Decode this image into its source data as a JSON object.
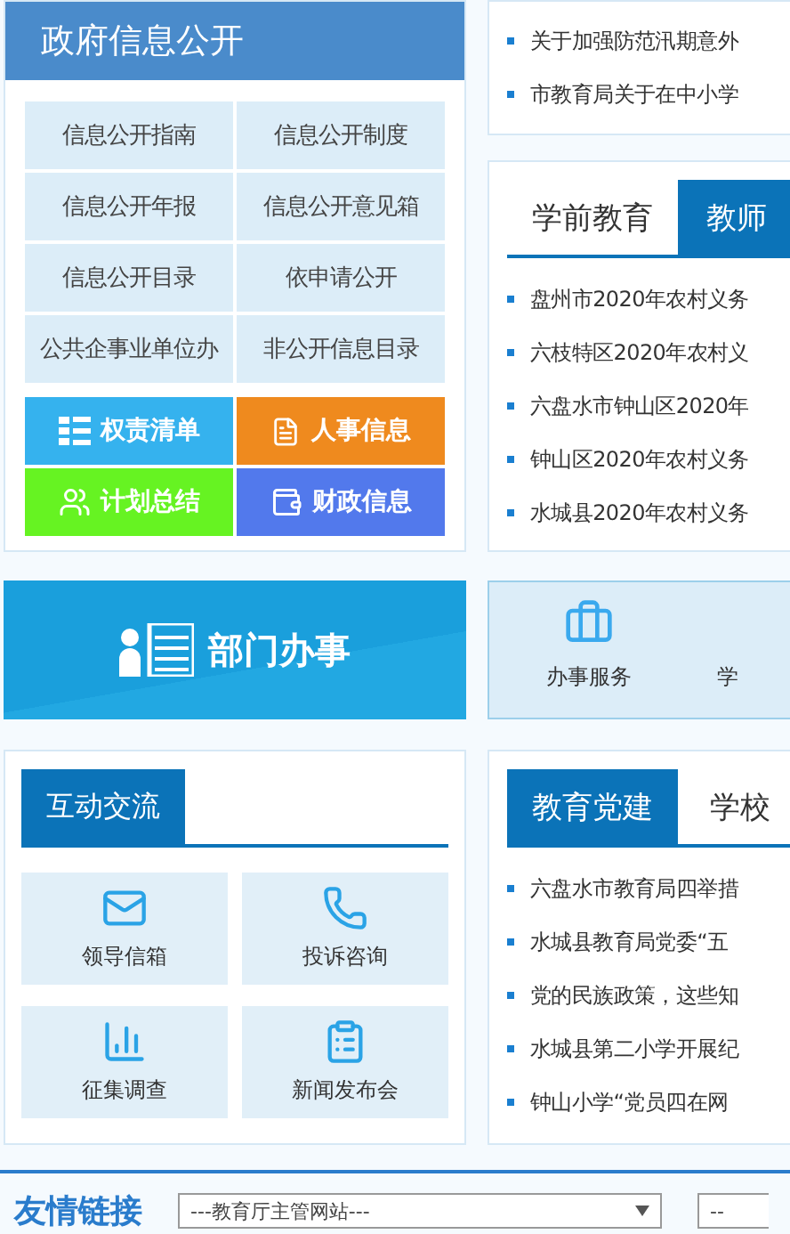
{
  "gov_info": {
    "title": "政府信息公开",
    "links": [
      "信息公开指南",
      "信息公开制度",
      "信息公开年报",
      "信息公开意见箱",
      "信息公开目录",
      "依申请公开",
      "公共企事业单位办",
      "非公开信息目录"
    ],
    "shortcuts": [
      {
        "label": "权责清单",
        "kind": "list",
        "color": "#35b2ee"
      },
      {
        "label": "人事信息",
        "kind": "document",
        "color": "#ef8a1e"
      },
      {
        "label": "计划总结",
        "kind": "people",
        "color": "#66f322"
      },
      {
        "label": "财政信息",
        "kind": "money",
        "color": "#5279ec"
      }
    ]
  },
  "notice_list": {
    "items": [
      "关于加强防范汛期意外",
      "市教育局关于在中小学"
    ]
  },
  "education_news": {
    "tabs": [
      {
        "label": "学前教育",
        "selected": false
      },
      {
        "label": "教师",
        "selected": true
      }
    ],
    "items": [
      "盘州市2020年农村义务",
      "六枝特区2020年农村义",
      "六盘水市钟山区2020年",
      "钟山区2020年农村义务",
      "水城县2020年农村义务"
    ]
  },
  "department": {
    "title": "部门办事"
  },
  "services": [
    {
      "label": "办事服务",
      "kind": "toolbox"
    },
    {
      "label": "学",
      "kind": "hidden"
    }
  ],
  "interaction": {
    "title": "互动交流",
    "tiles": [
      {
        "label": "领导信箱",
        "kind": "mail"
      },
      {
        "label": "投诉咨询",
        "kind": "phone"
      },
      {
        "label": "征集调查",
        "kind": "chart"
      },
      {
        "label": "新闻发布会",
        "kind": "clipboard"
      }
    ]
  },
  "party_news": {
    "tabs": [
      {
        "label": "教育党建",
        "selected": true
      },
      {
        "label": "学校",
        "selected": false
      }
    ],
    "items": [
      "六盘水市教育局四举措",
      "水城县教育局党委“五",
      "党的民族政策，这些知",
      "水城县第二小学开展纪",
      "钟山小学“党员四在网"
    ]
  },
  "friend_links": {
    "title": "友情链接",
    "selects": [
      {
        "value": "---教育厅主管网站---"
      },
      {
        "value": "--"
      }
    ]
  }
}
